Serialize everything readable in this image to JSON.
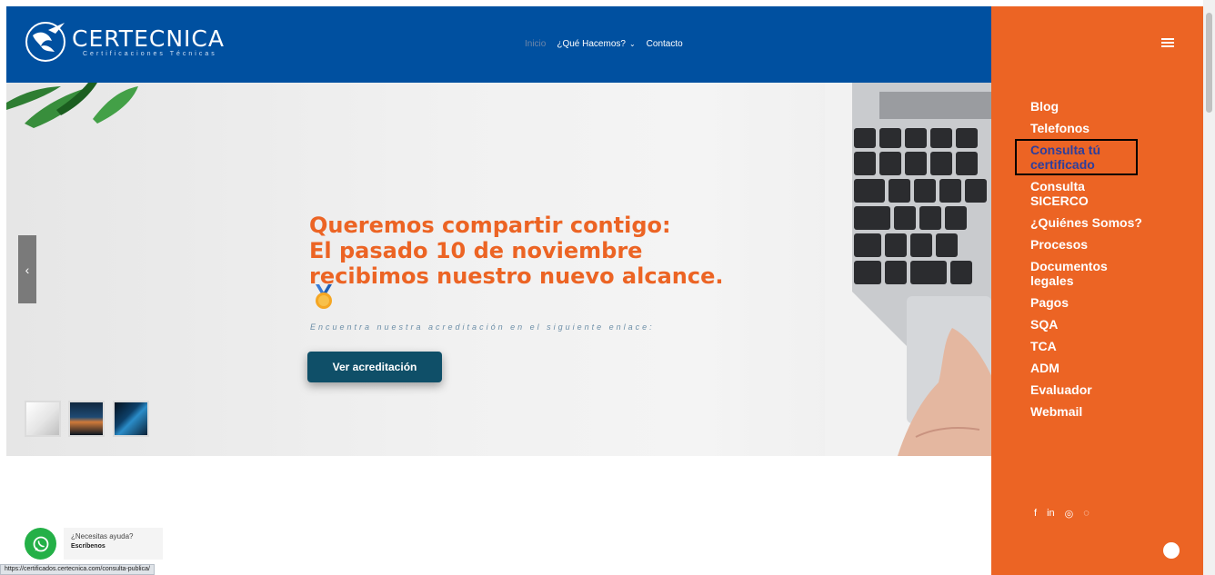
{
  "header": {
    "logo": {
      "brand": "CERTECNICA",
      "tagline": "Certificaciones Técnicas"
    },
    "nav": [
      {
        "label": "Inicio",
        "active": true
      },
      {
        "label": "¿Qué Hacemos?",
        "has_dropdown": true
      },
      {
        "label": "Contacto"
      }
    ]
  },
  "hero": {
    "title_lines": [
      "Queremos compartir contigo:",
      "El pasado 10 de noviembre",
      "recibimos nuestro nuevo alcance."
    ],
    "subtitle": "Encuentra nuestra acreditación en el siguiente enlace:",
    "cta_label": "Ver acreditación",
    "prev_glyph": "‹",
    "thumbnail_count": 3
  },
  "sidebar": {
    "menu": [
      "Blog",
      "Telefonos",
      "Consulta tú certificado",
      "Consulta SICERCO",
      "¿Quiénes Somos?",
      "Procesos",
      "Documentos legales",
      "Pagos",
      "SQA",
      "TCA",
      "ADM",
      "Evaluador",
      "Webmail"
    ],
    "highlighted_item": "Consulta tú certificado",
    "social": [
      "f",
      "in",
      "◎",
      "◌"
    ]
  },
  "whatsapp": {
    "question": "¿Necesitas ayuda?",
    "cta": "Escríbenos"
  },
  "status_url": "https://certificados.certecnica.com/consulta-publica/",
  "colors": {
    "header_blue": "#0050a0",
    "accent_orange": "#ec6424",
    "cta_teal": "#0f4f68",
    "whatsapp_green": "#24b047",
    "highlight_text": "#2c3e9e"
  }
}
